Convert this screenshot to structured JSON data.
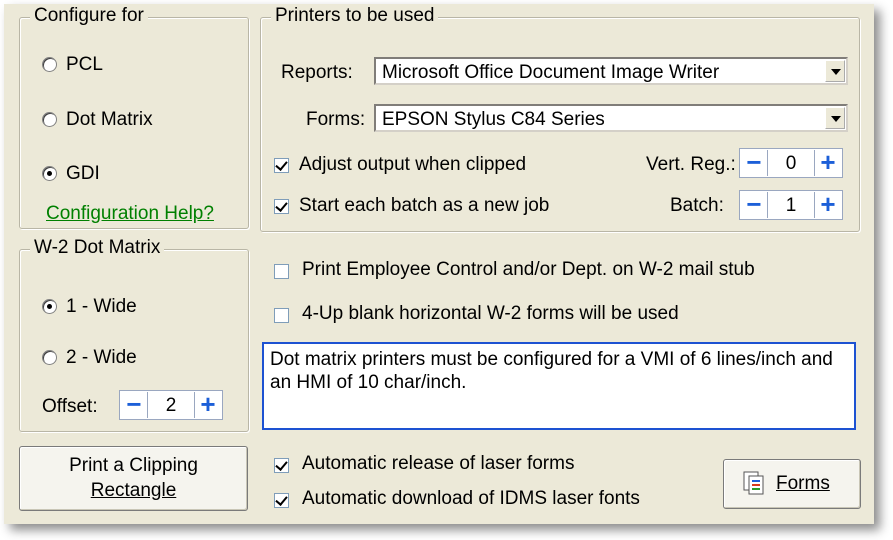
{
  "configure": {
    "legend": "Configure for",
    "options": [
      "PCL",
      "Dot Matrix",
      "GDI"
    ],
    "selected": "GDI",
    "help_link": "Configuration Help?"
  },
  "printers": {
    "legend": "Printers to be used",
    "reports_label": "Reports:",
    "reports_value": "Microsoft Office Document Image Writer",
    "forms_label": "Forms:",
    "forms_value": "EPSON Stylus C84 Series",
    "adjust_label": "Adjust output when clipped",
    "adjust_checked": true,
    "start_label": "Start each batch as a new job",
    "start_checked": true,
    "vert_reg_label": "Vert. Reg.:",
    "vert_reg_value": "0",
    "batch_label": "Batch:",
    "batch_value": "1"
  },
  "w2": {
    "legend": "W-2 Dot Matrix",
    "options": [
      "1 - Wide",
      "2 - Wide"
    ],
    "selected": "1 - Wide",
    "offset_label": "Offset:",
    "offset_value": "2"
  },
  "options": {
    "print_employee_label": "Print Employee Control and/or Dept. on W-2 mail stub",
    "print_employee_checked": false,
    "fourup_label": "4-Up blank horizontal W-2 forms will be used",
    "fourup_checked": false,
    "note": "Dot matrix printers must be configured for a VMI of 6 lines/inch and an HMI of 10 char/inch.",
    "auto_release_label": "Automatic release of laser forms",
    "auto_release_checked": true,
    "auto_download_label": "Automatic download of IDMS laser fonts",
    "auto_download_checked": true
  },
  "buttons": {
    "clipping_line1": "Print a Clipping",
    "clipping_line2": "Rectangle",
    "forms": "Forms"
  },
  "spinner": {
    "minus": "−",
    "plus": "+"
  }
}
